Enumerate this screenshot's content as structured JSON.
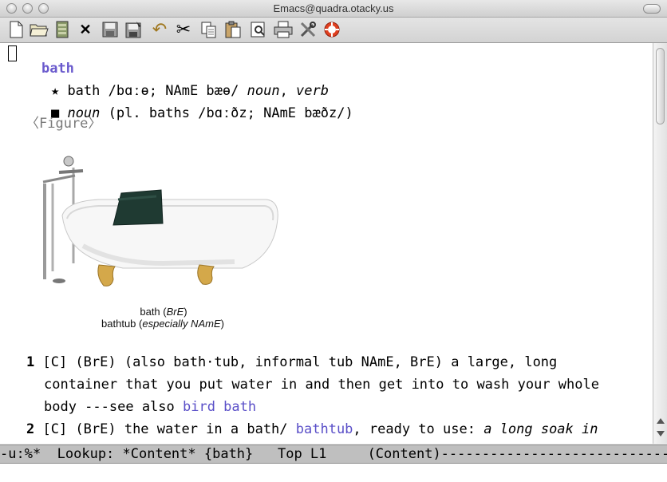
{
  "window": {
    "title": "Emacs@quadra.otacky.us"
  },
  "toolbar": {
    "buttons": [
      {
        "icon": "new-file-icon"
      },
      {
        "icon": "open-folder-icon"
      },
      {
        "icon": "dired-icon"
      },
      {
        "icon": "close-icon",
        "glyph": "✕"
      },
      {
        "icon": "save-icon"
      },
      {
        "icon": "save-as-icon"
      },
      {
        "icon": "undo-icon",
        "glyph": "↶"
      },
      {
        "icon": "cut-icon",
        "glyph": "✂"
      },
      {
        "icon": "copy-icon"
      },
      {
        "icon": "paste-icon"
      },
      {
        "icon": "search-icon"
      },
      {
        "icon": "print-icon"
      },
      {
        "icon": "preferences-icon"
      },
      {
        "icon": "help-icon"
      }
    ]
  },
  "entry": {
    "headword": "bath",
    "line2": {
      "star": "★",
      "pron": " bath /bɑːɵ; NAmE bæɵ/ ",
      "pos1": "noun",
      "comma": ", ",
      "pos2": "verb"
    },
    "line3": {
      "square": "■",
      "pos": "noun",
      "rest": " (pl. baths /bɑːðz; NAmE bæðz/)"
    },
    "figure_label": "〈Figure〉",
    "caption": {
      "line1_a": "bath (",
      "line1_i": "BrE",
      "line1_b": ")",
      "line2_a": "bathtub (",
      "line2_i": "especially NAmE",
      "line2_b": ")"
    },
    "sense1": {
      "num": "1",
      "l1": " [C] (BrE) (also bath·tub, informal tub NAmE, BrE) a large, long",
      "l2": "container that you put water in and then get into to wash your whole",
      "l3_a": "body ---see also ",
      "l3_link": "bird bath"
    },
    "sense2": {
      "num": "2",
      "l1_a": " [C] (BrE) the water in a bath/ ",
      "l1_link": "bathtub",
      "l1_b": ", ready to use: ",
      "l1_i": "a long soak in"
    }
  },
  "modeline": {
    "text": "-u:%*  Lookup: *Content* {bath}   Top L1     (Content)------------------------------------"
  }
}
